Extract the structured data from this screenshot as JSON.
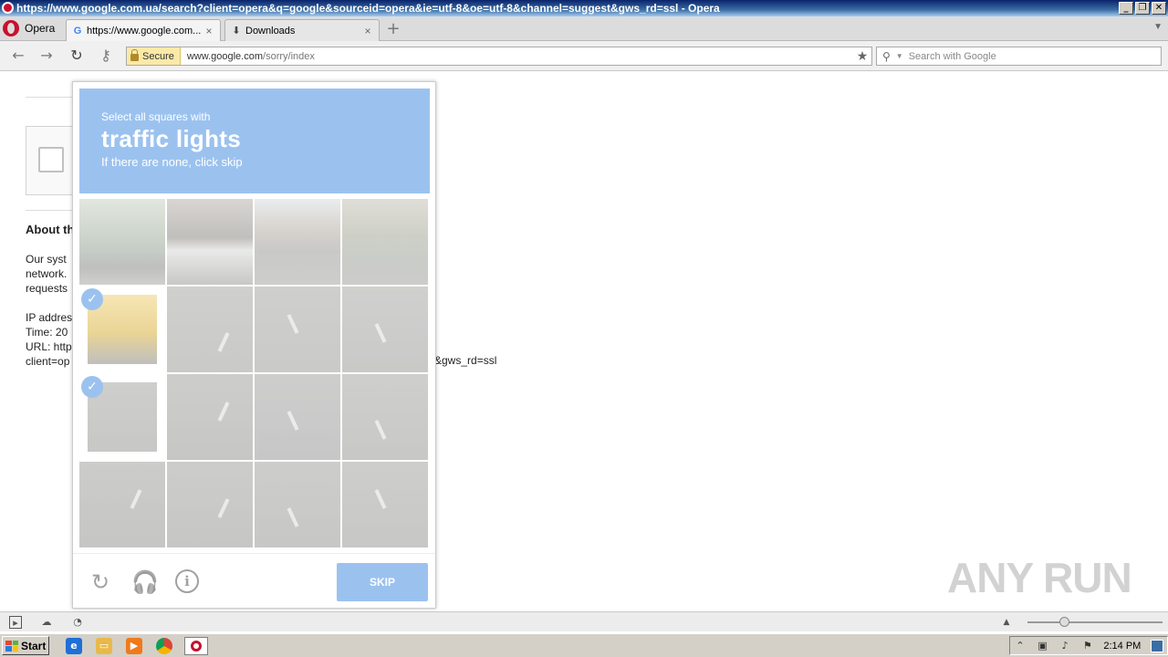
{
  "window": {
    "title": "https://www.google.com.ua/search?client=opera&q=google&sourceid=opera&ie=utf-8&oe=utf-8&channel=suggest&gws_rd=ssl - Opera",
    "buttons": [
      "_",
      "❐",
      "✕"
    ]
  },
  "tabs": {
    "menu_label": "Opera",
    "items": [
      {
        "title": "https://www.google.com...",
        "favicon": "G"
      },
      {
        "title": "Downloads",
        "favicon": "⬇"
      }
    ],
    "close_glyph": "×",
    "new_tab_glyph": "+"
  },
  "nav": {
    "secure_label": "Secure",
    "url_domain": "www.google.com",
    "url_path": "/sorry/index",
    "search_placeholder": "Search with Google"
  },
  "page": {
    "about_heading": "About th",
    "para_lines": [
      "Our syst",
      "network.",
      "requests"
    ],
    "info_lines": [
      "IP addres",
      "Time: 20",
      "URL: http",
      "client=op"
    ],
    "url_tail": "&gws_rd=ssl"
  },
  "captcha": {
    "instruction_small": "Select all squares with",
    "instruction_big": "traffic lights",
    "instruction_hint": "If there are none, click skip",
    "skip_label": "SKIP",
    "selected_tiles": [
      4,
      8
    ],
    "accent_color": "#4a90e2"
  },
  "taskbar": {
    "start_label": "Start",
    "clock": "2:14 PM"
  },
  "watermark": "ANY RUN"
}
